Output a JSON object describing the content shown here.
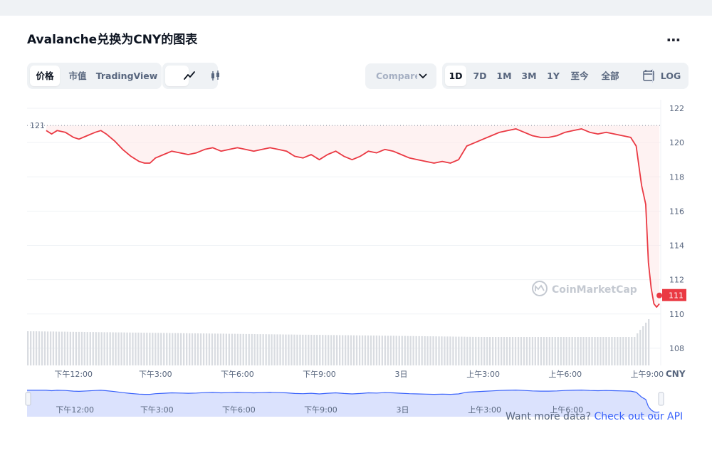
{
  "page": {
    "title": "Avalanche兑换为CNY的图表",
    "more_icon": "more-horizontal-icon",
    "view_tabs": [
      {
        "label": "价格",
        "active": true
      },
      {
        "label": "市值",
        "active": false
      },
      {
        "label": "TradingView",
        "active": false
      }
    ],
    "chart_type_icons": [
      "line-chart-icon",
      "candlestick-icon"
    ],
    "compare_label": "Compare with",
    "compare_icon": "chevron-down-icon",
    "range_tabs": [
      {
        "label": "1D",
        "active": true
      },
      {
        "label": "7D",
        "active": false
      },
      {
        "label": "1M",
        "active": false
      },
      {
        "label": "3M",
        "active": false
      },
      {
        "label": "1Y",
        "active": false
      },
      {
        "label": "至今",
        "active": false
      },
      {
        "label": "全部",
        "active": false
      }
    ],
    "calendar_icon": "calendar-icon",
    "log_label": "LOG",
    "watermark": "CoinMarketCap",
    "currency": "CNY",
    "more_data_text": "Want more data?",
    "more_data_link": "Check out our API"
  },
  "chart_data": {
    "type": "line",
    "y_ticks": [
      108,
      110,
      112,
      114,
      116,
      118,
      120,
      122
    ],
    "ylim": [
      107,
      122.5
    ],
    "x_range": [
      10.3,
      33.5
    ],
    "x_ticks": [
      {
        "x": 12,
        "label": "下午12:00"
      },
      {
        "x": 15,
        "label": "下午3:00"
      },
      {
        "x": 18,
        "label": "下午6:00"
      },
      {
        "x": 21,
        "label": "下午9:00"
      },
      {
        "x": 24,
        "label": "3日"
      },
      {
        "x": 27,
        "label": "上午3:00"
      },
      {
        "x": 30,
        "label": "上午6:00"
      },
      {
        "x": 33,
        "label": "上午9:00"
      }
    ],
    "open_price": 121,
    "open_price_label": "121",
    "last_price": 111,
    "last_price_label": "111",
    "colors": {
      "line": "#ea3943",
      "fill": "#fde7e8",
      "volume": "#d9dce1",
      "nav_line": "#3861fb",
      "nav_fill": "#dbe2fd"
    },
    "series": [
      {
        "x": [
          11.0,
          11.2,
          11.4,
          11.7,
          12.0,
          12.2,
          12.5,
          12.8,
          13.0,
          13.2,
          13.5,
          13.8,
          14.1,
          14.4,
          14.6,
          14.8,
          15.0,
          15.3,
          15.6,
          15.9,
          16.2,
          16.5,
          16.8,
          17.1,
          17.4,
          17.7,
          18.0,
          18.3,
          18.6,
          18.9,
          19.2,
          19.5,
          19.8,
          20.1,
          20.4,
          20.7,
          21.0,
          21.3,
          21.6,
          21.9,
          22.2,
          22.5,
          22.8,
          23.1,
          23.4,
          23.7,
          24.0,
          24.3,
          24.6,
          24.9,
          25.2,
          25.5,
          25.8,
          26.1,
          26.4,
          26.7,
          27.0,
          27.3,
          27.6,
          27.9,
          28.2,
          28.5,
          28.8,
          29.1,
          29.4,
          29.7,
          30.0,
          30.3,
          30.6,
          30.9,
          31.2,
          31.5,
          31.8,
          32.1,
          32.4,
          32.6,
          32.8,
          32.95,
          33.05,
          33.15,
          33.25,
          33.35,
          33.45
        ],
        "y": [
          120.7,
          120.5,
          120.7,
          120.6,
          120.3,
          120.2,
          120.4,
          120.6,
          120.7,
          120.5,
          120.1,
          119.6,
          119.2,
          118.9,
          118.8,
          118.8,
          119.1,
          119.3,
          119.5,
          119.4,
          119.3,
          119.4,
          119.6,
          119.7,
          119.5,
          119.6,
          119.7,
          119.6,
          119.5,
          119.6,
          119.7,
          119.6,
          119.5,
          119.2,
          119.1,
          119.3,
          119.0,
          119.3,
          119.5,
          119.2,
          119.0,
          119.2,
          119.5,
          119.4,
          119.6,
          119.5,
          119.3,
          119.1,
          119.0,
          118.9,
          118.8,
          118.9,
          118.8,
          119.0,
          119.8,
          120.0,
          120.2,
          120.4,
          120.6,
          120.7,
          120.8,
          120.6,
          120.4,
          120.3,
          120.3,
          120.4,
          120.6,
          120.7,
          120.8,
          120.6,
          120.5,
          120.6,
          120.5,
          120.4,
          120.3,
          119.8,
          117.5,
          116.4,
          113.0,
          111.5,
          110.6,
          110.4,
          110.6
        ]
      }
    ],
    "volume_x_range": [
      10.3,
      33.5
    ],
    "nav_ticks": [
      {
        "x": 12,
        "label": "下午12:00"
      },
      {
        "x": 15,
        "label": "下午3:00"
      },
      {
        "x": 18,
        "label": "下午6:00"
      },
      {
        "x": 21,
        "label": "下午9:00"
      },
      {
        "x": 24,
        "label": "3日"
      },
      {
        "x": 27,
        "label": "上午3:00"
      },
      {
        "x": 30,
        "label": "上午6:00"
      }
    ]
  }
}
